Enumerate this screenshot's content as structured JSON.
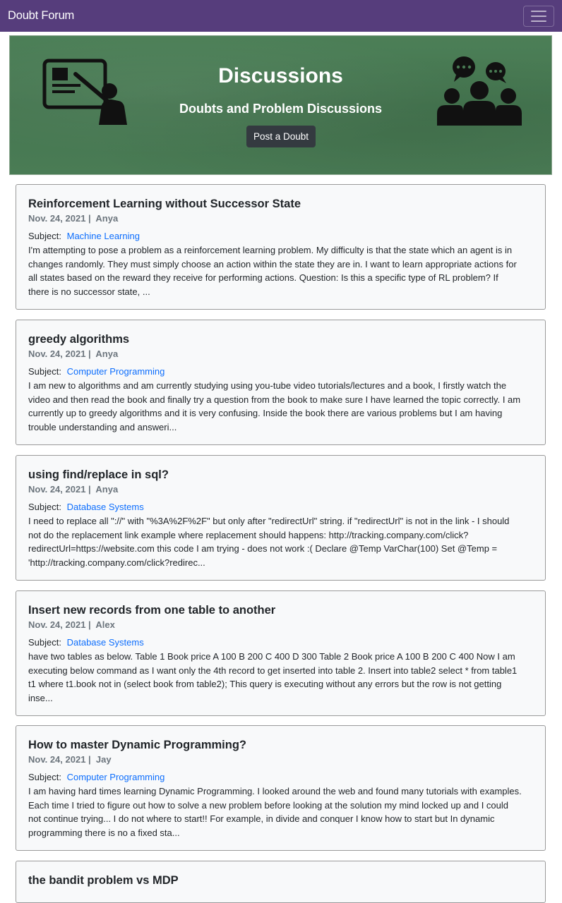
{
  "navbar": {
    "brand": "Doubt Forum",
    "menu_icon": "hamburger-icon"
  },
  "hero": {
    "title": "Discussions",
    "subtitle": "Doubts and Problem Discussions",
    "post_button": "Post a Doubt",
    "left_icon": "teacher-board-icon",
    "right_icon": "group-chat-icon",
    "color_bg": "#487a53"
  },
  "subject_label": "Subject:",
  "posts": [
    {
      "title": "Reinforcement Learning without Successor State",
      "date": "Nov. 24, 2021",
      "author": "Anya",
      "subject": "Machine Learning",
      "lines": [
        "I'm attempting to pose a problem as a reinforcement learning problem. My difficulty is that the state which an agent is in",
        "changes randomly. They must simply choose an action within the state they are in. I want to learn appropriate actions for",
        "all states based on the reward they receive for performing actions. Question: Is this a specific type of RL problem? If",
        "there is no successor state, ..."
      ]
    },
    {
      "title": "greedy algorithms",
      "date": "Nov. 24, 2021",
      "author": "Anya",
      "subject": "Computer Programming",
      "lines": [
        "I am new to algorithms and am currently studying using you-tube video tutorials/lectures and a book, I firstly watch the",
        "video and then read the book and finally try a question from the book to make sure I have learned the topic correctly. I am",
        "currently up to greedy algorithms and it is very confusing. Inside the book there are various problems but I am having",
        "trouble understanding and answeri..."
      ]
    },
    {
      "title": "using find/replace in sql?",
      "date": "Nov. 24, 2021",
      "author": "Anya",
      "subject": "Database Systems",
      "lines": [
        "I need to replace all \"://\" with \"%3A%2F%2F\" but only after \"redirectUrl\" string. if \"redirectUrl\" is not in the link - I should",
        "not do the replacement link example where replacement should happens: http://tracking.company.com/click?",
        "redirectUrl=https://website.com this code I am trying - does not work :( Declare @Temp VarChar(100) Set @Temp =",
        "'http://tracking.company.com/click?redirec..."
      ]
    },
    {
      "title": "Insert new records from one table to another",
      "date": "Nov. 24, 2021",
      "author": "Alex",
      "subject": "Database Systems",
      "lines": [
        "have two tables as below. Table 1 Book price A 100 B 200 C 400 D 300 Table 2 Book price A 100 B 200 C 400 Now I am",
        "executing below command as I want only the 4th record to get inserted into table 2. Insert into table2 select * from table1",
        "t1 where t1.book not in (select book from table2); This query is executing without any errors but the row is not getting",
        "inse..."
      ]
    },
    {
      "title": "How to master Dynamic Programming?",
      "date": "Nov. 24, 2021",
      "author": "Jay",
      "subject": "Computer Programming",
      "lines": [
        "I am having hard times learning Dynamic Programming. I looked around the web and found many tutorials with examples.",
        "Each time I tried to figure out how to solve a new problem before looking at the solution my mind locked up and I could",
        "not continue trying... I do not where to start!! For example, in divide and conquer I know how to start but In dynamic",
        "programming there is no a fixed sta..."
      ]
    },
    {
      "title": "the bandit problem vs MDP",
      "date": "",
      "author": "",
      "subject": "",
      "lines": []
    }
  ]
}
